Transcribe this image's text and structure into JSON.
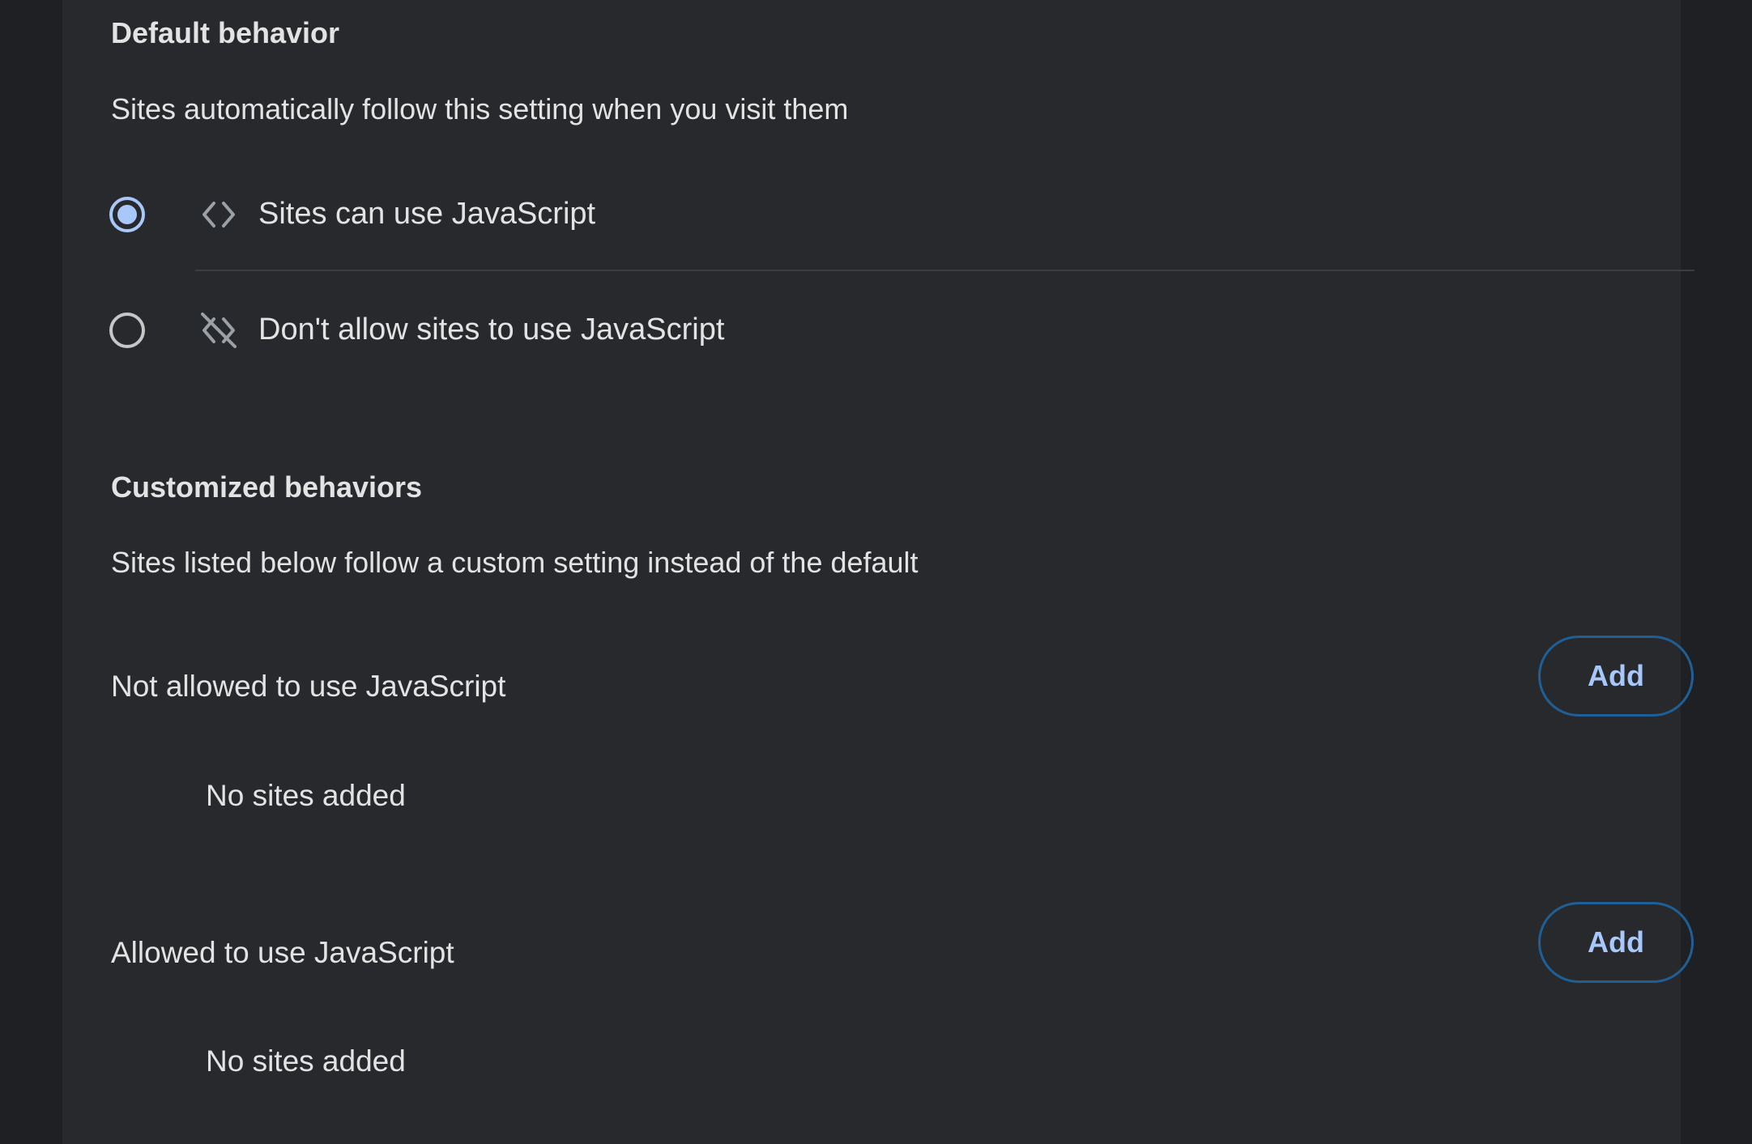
{
  "default_behavior": {
    "title": "Default behavior",
    "description": "Sites automatically follow this setting when you visit them",
    "options": [
      {
        "label": "Sites can use JavaScript",
        "icon": "code-brackets-icon",
        "selected": true
      },
      {
        "label": "Don't allow sites to use JavaScript",
        "icon": "code-off-icon",
        "selected": false
      }
    ]
  },
  "customized_behaviors": {
    "title": "Customized behaviors",
    "description": "Sites listed below follow a custom setting instead of the default",
    "lists": [
      {
        "label": "Not allowed to use JavaScript",
        "add_label": "Add",
        "empty_text": "No sites added"
      },
      {
        "label": "Allowed to use JavaScript",
        "add_label": "Add",
        "empty_text": "No sites added"
      }
    ]
  },
  "colors": {
    "background": "#1f2023",
    "card": "#28292c",
    "accent": "#a8c7fa",
    "button_border": "#1f5f96",
    "text": "#e3e3e3",
    "radio_unselected": "#c4c7c5"
  }
}
